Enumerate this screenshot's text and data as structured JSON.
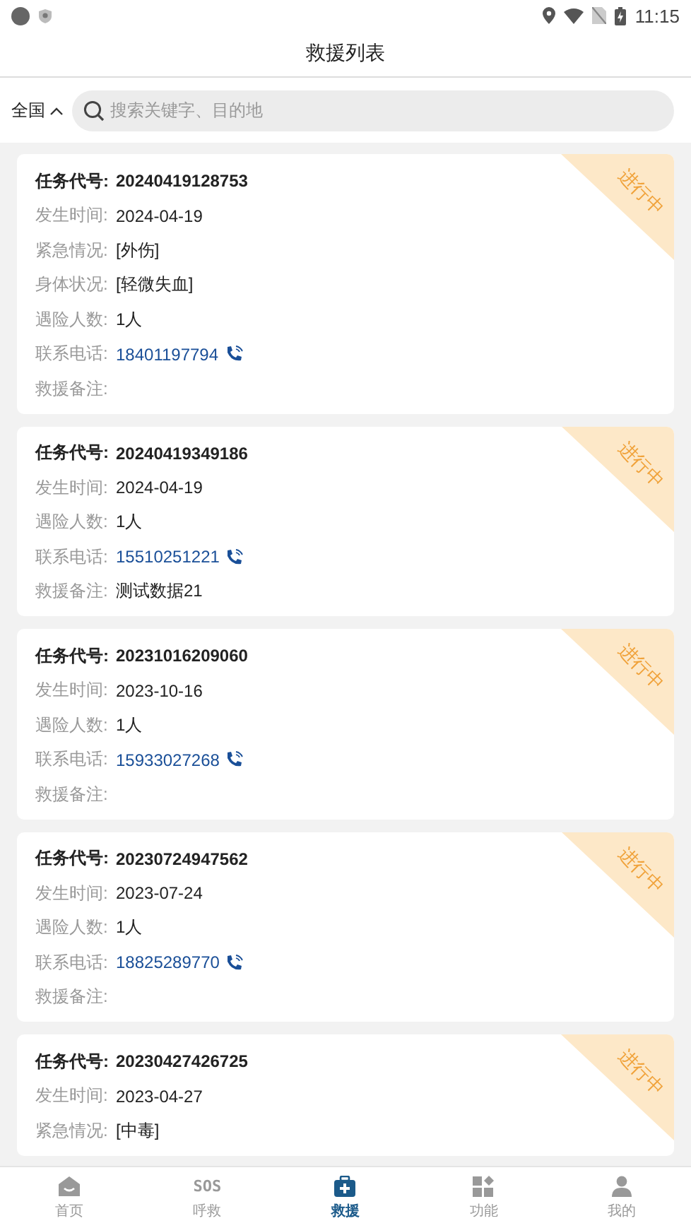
{
  "status_bar": {
    "time": "11:15"
  },
  "header": {
    "title": "救援列表"
  },
  "filter": {
    "region": "全国",
    "expanded": true
  },
  "search": {
    "placeholder": "搜索关键字、目的地"
  },
  "tasks": [
    {
      "status": "进行中",
      "fields": [
        {
          "kind": "id",
          "label": "任务代号:",
          "value": "20240419128753"
        },
        {
          "kind": "text",
          "label": "发生时间:",
          "value": "2024-04-19"
        },
        {
          "kind": "text",
          "label": "紧急情况:",
          "value": "[外伤]"
        },
        {
          "kind": "text",
          "label": "身体状况:",
          "value": "[轻微失血]"
        },
        {
          "kind": "text",
          "label": "遇险人数:",
          "value": "1人"
        },
        {
          "kind": "phone",
          "label": "联系电话:",
          "value": "18401197794"
        },
        {
          "kind": "text",
          "label": "救援备注:"
        }
      ]
    },
    {
      "status": "进行中",
      "fields": [
        {
          "kind": "id",
          "label": "任务代号:",
          "value": "20240419349186"
        },
        {
          "kind": "text",
          "label": "发生时间:",
          "value": "2024-04-19"
        },
        {
          "kind": "text",
          "label": "遇险人数:",
          "value": "1人"
        },
        {
          "kind": "phone",
          "label": "联系电话:",
          "value": "15510251221"
        },
        {
          "kind": "text",
          "label": "救援备注:",
          "value": "测试数据21"
        }
      ]
    },
    {
      "status": "进行中",
      "fields": [
        {
          "kind": "id",
          "label": "任务代号:",
          "value": "20231016209060"
        },
        {
          "kind": "text",
          "label": "发生时间:",
          "value": "2023-10-16"
        },
        {
          "kind": "text",
          "label": "遇险人数:",
          "value": "1人"
        },
        {
          "kind": "phone",
          "label": "联系电话:",
          "value": "15933027268"
        },
        {
          "kind": "text",
          "label": "救援备注:"
        }
      ]
    },
    {
      "status": "进行中",
      "fields": [
        {
          "kind": "id",
          "label": "任务代号:",
          "value": "20230724947562"
        },
        {
          "kind": "text",
          "label": "发生时间:",
          "value": "2023-07-24"
        },
        {
          "kind": "text",
          "label": "遇险人数:",
          "value": "1人"
        },
        {
          "kind": "phone",
          "label": "联系电话:",
          "value": "18825289770"
        },
        {
          "kind": "text",
          "label": "救援备注:"
        }
      ]
    },
    {
      "status": "进行中",
      "fields": [
        {
          "kind": "id",
          "label": "任务代号:",
          "value": "20230427426725"
        },
        {
          "kind": "text",
          "label": "发生时间:",
          "value": "2023-04-27"
        },
        {
          "kind": "text",
          "label": "紧急情况:",
          "value": "[中毒]"
        }
      ]
    }
  ],
  "tab_bar": [
    {
      "kind": "home",
      "label": "首页",
      "selected": false
    },
    {
      "kind": "sos",
      "icon_text": "SOS",
      "label": "呼救",
      "selected": false
    },
    {
      "kind": "kit",
      "label": "救援",
      "selected": true
    },
    {
      "kind": "grid",
      "label": "功能",
      "selected": false
    },
    {
      "kind": "person",
      "label": "我的",
      "selected": false
    }
  ]
}
